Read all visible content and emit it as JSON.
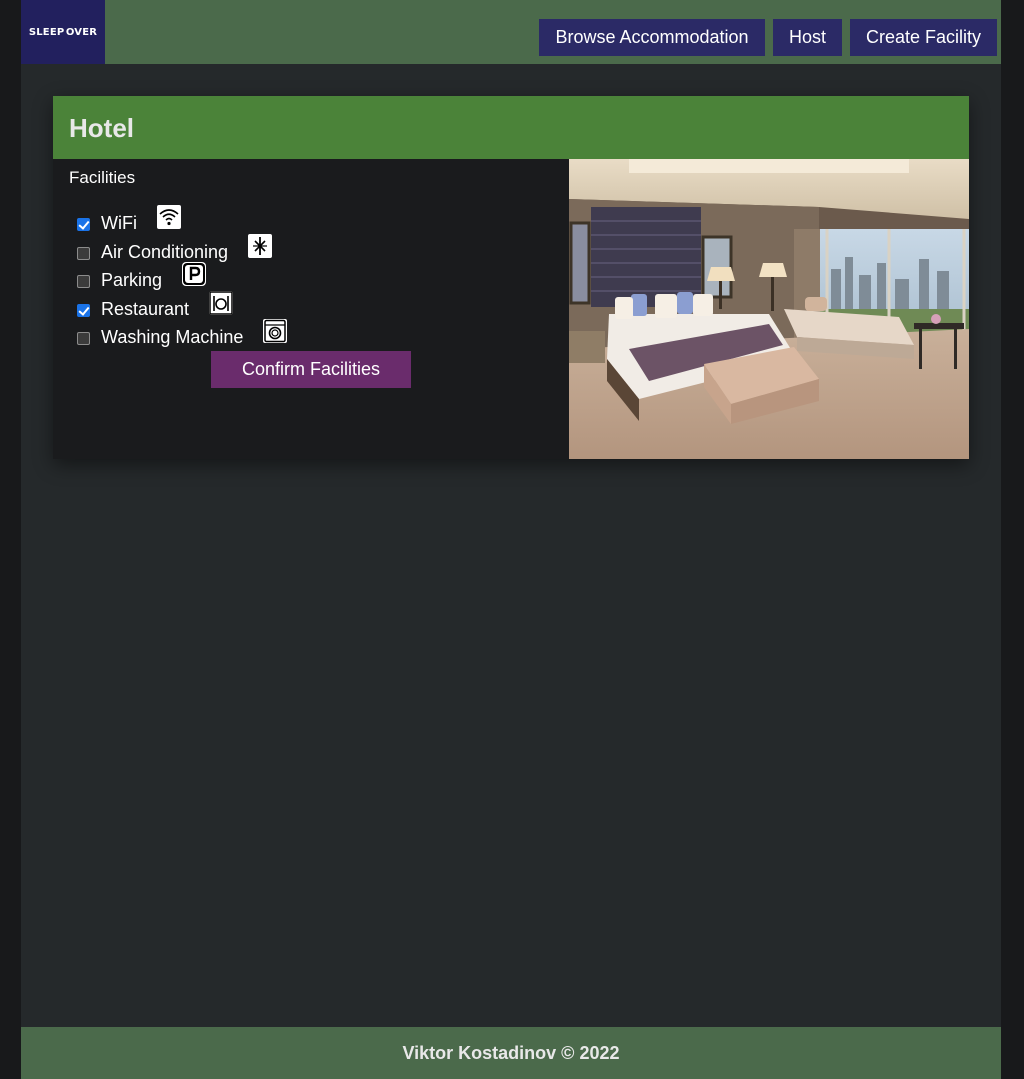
{
  "navbar": {
    "logo_text": "SLEEP OVER",
    "items": [
      {
        "label": "Browse Accommodation"
      },
      {
        "label": "Host"
      },
      {
        "label": "Create Facility"
      }
    ]
  },
  "card": {
    "title": "Hotel",
    "facilities_label": "Facilities",
    "facilities": [
      {
        "label": "WiFi",
        "checked": true,
        "icon": "wifi-icon"
      },
      {
        "label": "Air Conditioning",
        "checked": false,
        "icon": "air-conditioning-icon"
      },
      {
        "label": "Parking",
        "checked": false,
        "icon": "parking-icon"
      },
      {
        "label": "Restaurant",
        "checked": true,
        "icon": "restaurant-icon"
      },
      {
        "label": "Washing Machine",
        "checked": false,
        "icon": "washing-machine-icon"
      }
    ],
    "confirm_label": "Confirm Facilities"
  },
  "footer": {
    "text": "Viktor Kostadinov © 2022"
  },
  "colors": {
    "navbar_bg": "#4b6a4b",
    "logo_bg": "#22205e",
    "nav_button_bg": "#2b2a66",
    "card_header_bg": "#4b8339",
    "confirm_button_bg": "#6a2c6c",
    "page_bg": "#25292b",
    "checkbox_checked": "#1a73e8"
  }
}
